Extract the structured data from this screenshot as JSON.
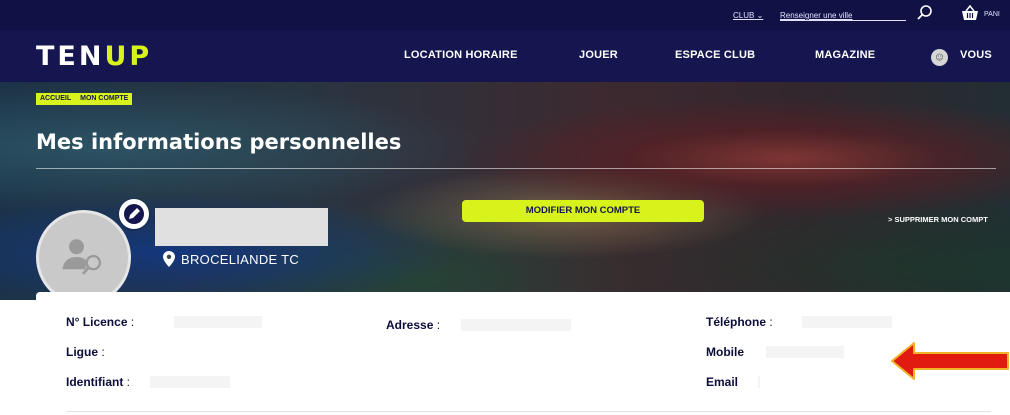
{
  "utility_bar": {
    "club_label": "CLUB",
    "city_link": "Renseigner une ville",
    "basket_label": "PANI",
    "icons": [
      "chevron-down-icon",
      "search-icon",
      "basket-icon"
    ]
  },
  "nav": {
    "logo_main": "TEN",
    "logo_accent": "UP",
    "items": [
      "LOCATION HORAIRE",
      "JOUER",
      "ESPACE CLUB",
      "MAGAZINE"
    ],
    "user_label": "VOUS"
  },
  "hero": {
    "breadcrumb": [
      "ACCUEIL",
      "MON COMPTE"
    ],
    "title": "Mes informations personnelles",
    "club_name": "BROCELIANDE TC",
    "modify_button": "MODIFIER MON COMPTE",
    "delete_link": "> SUPPRIMER MON COMPT"
  },
  "info": {
    "licence_label": "N° Licence",
    "ligue_label": "Ligue",
    "identifiant_label": "Identifiant",
    "adresse_label": "Adresse",
    "telephone_label": "Téléphone",
    "mobile_label": "Mobile",
    "email_label": "Email",
    "colon": " :"
  },
  "colors": {
    "nav_background": "#15164f",
    "accent_yellow": "#d8f31b",
    "arrow_red": "#e21b10"
  }
}
